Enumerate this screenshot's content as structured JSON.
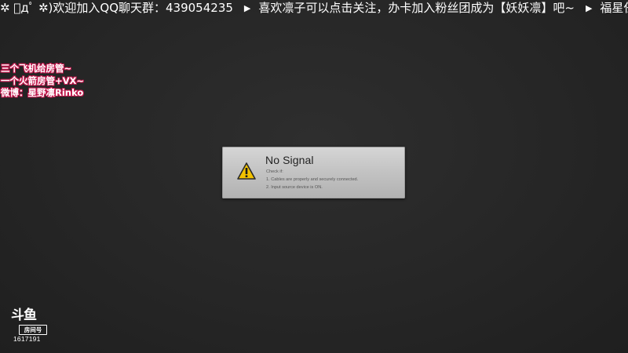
{
  "marquee": {
    "item1": "✲ ﾟдﾟ ✲)欢迎加入QQ聊天群：439054235",
    "separator": "▶",
    "item2": "喜欢凛子可以点击关注，办卡加入粉丝团成为【妖妖凛】吧~",
    "item3": "福星任"
  },
  "notes": {
    "line1": "三个飞机给房管~",
    "line2": "一个火箭房管+VX~",
    "line3": "微博：星野凛Rinko"
  },
  "dialog": {
    "title": "No Signal",
    "check_label": "Check if:",
    "item1": "1. Cables are properly and securely connected.",
    "item2": "2. Input source device is ON.",
    "icon": "warning-icon"
  },
  "logo": {
    "brand": "斗鱼",
    "room_label": "房间号",
    "room_id": "1617191"
  },
  "colors": {
    "background": "#262626",
    "note_outline": "#c2184d",
    "warning_yellow": "#f2c200"
  }
}
